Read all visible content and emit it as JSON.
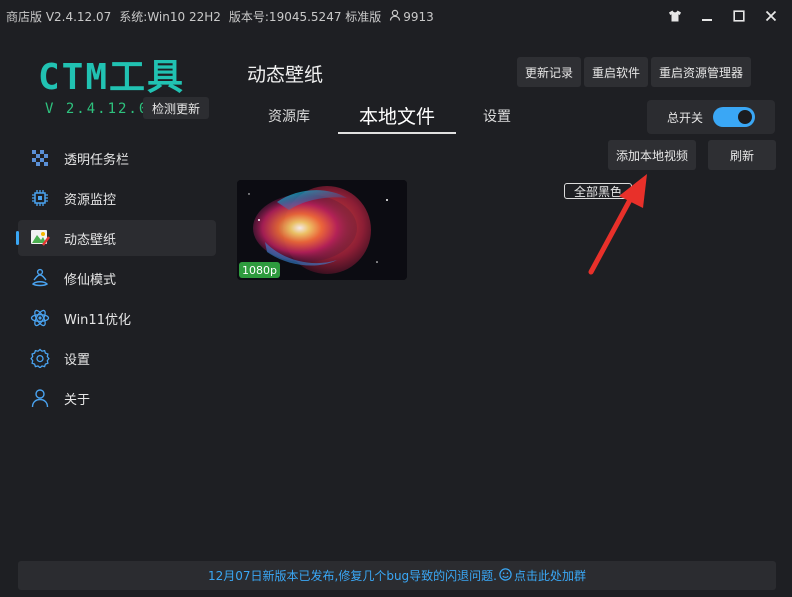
{
  "titlebar": {
    "edition": "商店版 V2.4.12.07",
    "system": "系统:Win10 22H2",
    "build": "版本号:19045.5247 标准版",
    "user_count": "9913"
  },
  "brand": {
    "logo": "CTM工具",
    "version": "V 2.4.12.07",
    "check_update": "检测更新",
    "accent": "#21c2b2"
  },
  "sidebar": {
    "items": [
      {
        "label": "透明任务栏",
        "icon": "taskbar-icon"
      },
      {
        "label": "资源监控",
        "icon": "chip-icon"
      },
      {
        "label": "动态壁纸",
        "icon": "wallpaper-icon"
      },
      {
        "label": "修仙模式",
        "icon": "meditation-icon"
      },
      {
        "label": "Win11优化",
        "icon": "atom-icon"
      },
      {
        "label": "设置",
        "icon": "gear-icon"
      },
      {
        "label": "关于",
        "icon": "user-icon"
      }
    ],
    "active_index": 2
  },
  "header": {
    "title": "动态壁纸",
    "buttons": [
      "更新记录",
      "重启软件",
      "重启资源管理器"
    ]
  },
  "tabs": [
    {
      "label": "资源库"
    },
    {
      "label": "本地文件"
    },
    {
      "label": "设置"
    }
  ],
  "active_tab": 1,
  "master_switch": {
    "label": "总开关",
    "on": true
  },
  "actions": {
    "add_local_video": "添加本地视频",
    "refresh": "刷新",
    "all_black": "全部黑色"
  },
  "wallpapers": [
    {
      "resolution": "1080p"
    }
  ],
  "footer": {
    "notice": "12月07日新版本已发布,修复几个bug导致的闪退问题.",
    "join": "点击此处加群"
  },
  "colors": {
    "background": "#1e1f23",
    "panel": "#2b2c30",
    "toggle_on": "#3aa7f5",
    "version_green": "#2ec27e",
    "badge_green": "#2e9b3e",
    "footer_text": "#3aa7f5",
    "annotation_arrow": "#e8302a"
  }
}
